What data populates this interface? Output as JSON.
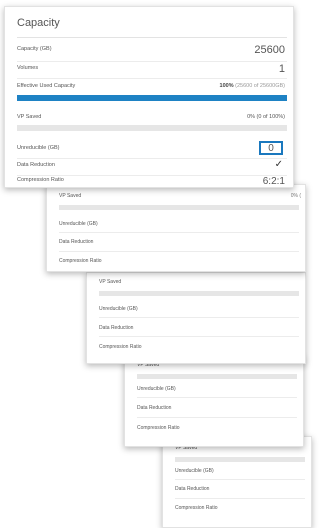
{
  "main": {
    "title": "Capacity",
    "capacity_label": "Capacity (GB)",
    "capacity_value": "25600",
    "volumes_label": "Volumes",
    "volumes_value": "1",
    "effective_label": "Effective Used Capacity",
    "effective_value_bold": "100%",
    "effective_value_detail": "(25600 of 25600GB)",
    "effective_fraction": 1.0,
    "vp_saved_label": "VP Saved",
    "vp_saved_value": "0% (0 of 100%)",
    "vp_saved_fraction": 0.0,
    "unreducible_label": "Unreducible (GB)",
    "unreducible_value": "0",
    "data_reduction_label": "Data Reduction",
    "data_reduction_icon": "checkmark-icon",
    "data_reduction_glyph": "✓",
    "compression_label": "Compression Ratio",
    "compression_value": "6:2:1"
  },
  "stack_cards": [
    {
      "vp_saved_label": "VP Saved",
      "vp_saved_value": "0% (",
      "unreducible_label": "Unreducible (GB)",
      "data_reduction_label": "Data Reduction",
      "compression_label": "Compression Ratio"
    },
    {
      "vp_saved_label": "VP Saved",
      "unreducible_label": "Unreducible (GB)",
      "data_reduction_label": "Data Reduction",
      "compression_label": "Compression Ratio"
    },
    {
      "vp_saved_label": "VP Saved",
      "unreducible_label": "Unreducible (GB)",
      "data_reduction_label": "Data Reduction",
      "compression_label": "Compression Ratio"
    },
    {
      "vp_saved_label": "VP Saved",
      "unreducible_label": "Unreducible (GB)",
      "data_reduction_label": "Data Reduction",
      "compression_label": "Compression Ratio"
    }
  ],
  "colors": {
    "accent": "#1e82c4",
    "highlight_border": "#1a78be"
  }
}
